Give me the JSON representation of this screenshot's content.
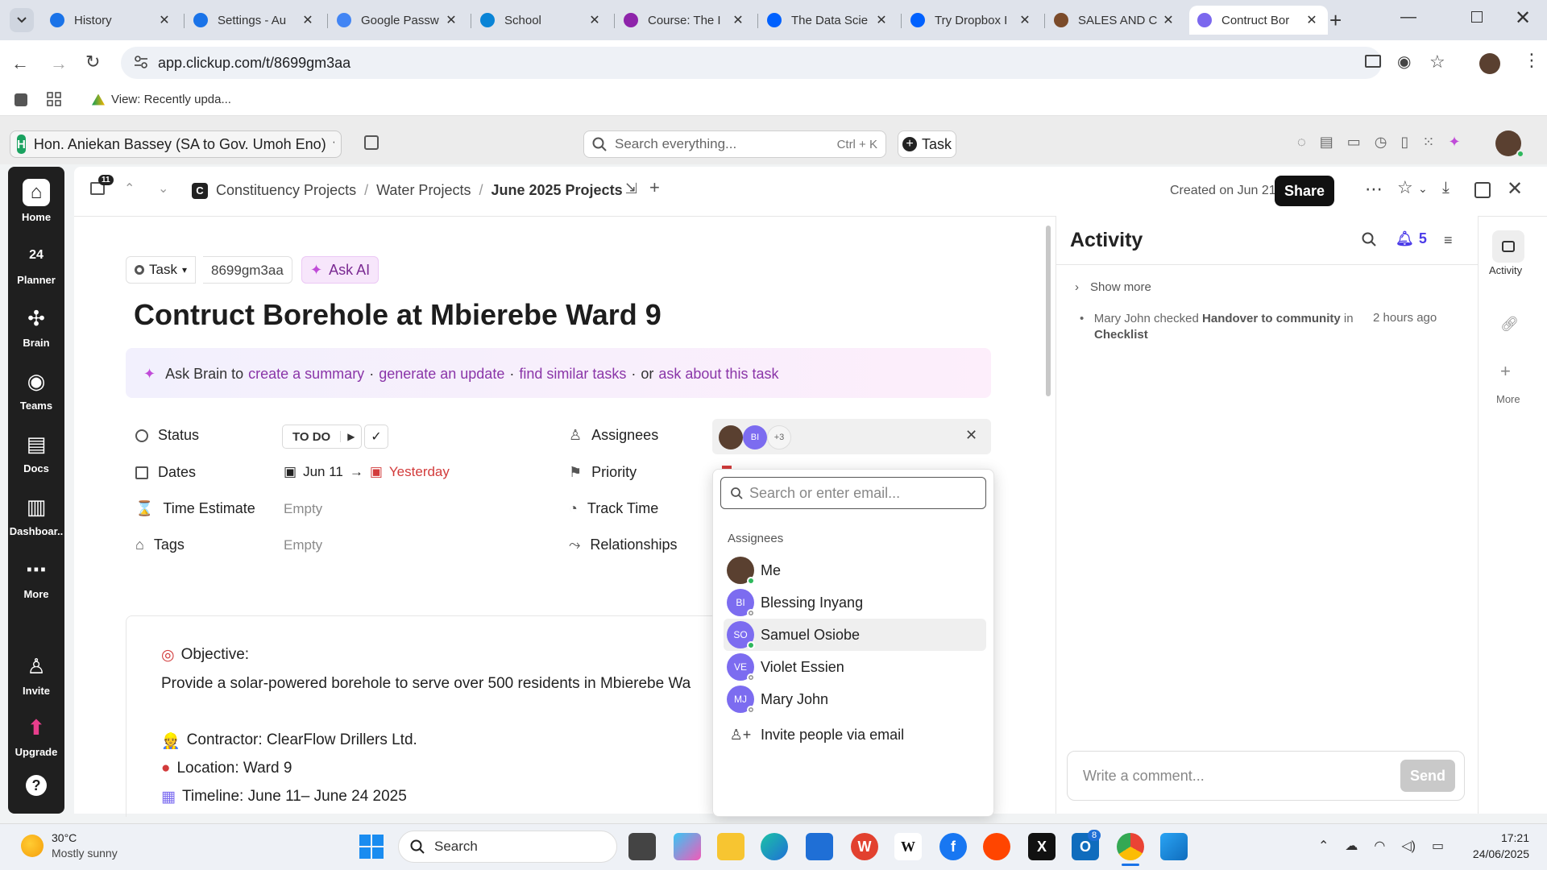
{
  "browser": {
    "tabs": [
      {
        "title": "History",
        "color": "#1a73e8"
      },
      {
        "title": "Settings - Au",
        "color": "#1a73e8"
      },
      {
        "title": "Google Passw",
        "color": "#4285f4"
      },
      {
        "title": "School",
        "color": "#0a84d6"
      },
      {
        "title": "Course: The I",
        "color": "#8e24aa"
      },
      {
        "title": "The Data Scie",
        "color": "#0061fe"
      },
      {
        "title": "Try Dropbox I",
        "color": "#0061fe"
      },
      {
        "title": "SALES AND C",
        "color": "#7b4b2a"
      },
      {
        "title": "Contruct Bor",
        "color": "#7b68ee"
      }
    ],
    "url": "app.clickup.com/t/8699gm3aa",
    "bookmark": "View: Recently upda..."
  },
  "clickup": {
    "workspace_initial": "H",
    "workspace": "Hon. Aniekan Bassey (SA to Gov. Umoh Eno)",
    "search_placeholder": "Search everything...",
    "search_shortcut": "Ctrl + K",
    "task_button": "Task",
    "rail": [
      {
        "label": "Home",
        "icon": "home-icon"
      },
      {
        "label": "Planner",
        "icon": "calendar-icon"
      },
      {
        "label": "Brain",
        "icon": "brain-icon"
      },
      {
        "label": "Teams",
        "icon": "teams-icon"
      },
      {
        "label": "Docs",
        "icon": "docs-icon"
      },
      {
        "label": "Dashboar..",
        "icon": "dashboard-icon"
      },
      {
        "label": "More",
        "icon": "more-icon"
      },
      {
        "label": "Invite",
        "icon": "invite-icon"
      },
      {
        "label": "Upgrade",
        "icon": "upgrade-icon"
      }
    ],
    "planner_badge": "24",
    "notif_badge": "11",
    "breadcrumb": {
      "space_initial": "C",
      "space": "Constituency Projects",
      "folder": "Water Projects",
      "list": "June 2025 Projects"
    },
    "created": "Created on Jun 21",
    "share": "Share"
  },
  "task": {
    "type": "Task",
    "id": "8699gm3aa",
    "ask_ai": "Ask AI",
    "title": "Contruct Borehole at Mbierebe Ward 9",
    "brain": {
      "prefix": "Ask Brain to",
      "link1": "create a summary",
      "link2": "generate an update",
      "link3": "find similar tasks",
      "or": "or",
      "link4": "ask about this task"
    },
    "props": {
      "status_label": "Status",
      "status_value": "TO DO",
      "dates_label": "Dates",
      "start": "Jun 11",
      "due": "Yesterday",
      "time_label": "Time Estimate",
      "time_value": "Empty",
      "tags_label": "Tags",
      "tags_value": "Empty",
      "assignees_label": "Assignees",
      "assignee_more": "+3",
      "priority_label": "Priority",
      "track_label": "Track Time",
      "rel_label": "Relationships"
    },
    "description": {
      "objective_heading": "Objective:",
      "objective": "Provide a solar-powered borehole to serve over 500 residents in Mbierebe Wa",
      "contractor": "Contractor: ClearFlow Drillers Ltd.",
      "location": "Location: Ward 9",
      "timeline": "Timeline: June 11– June 24 2025"
    }
  },
  "dropdown": {
    "search_placeholder": "Search or enter email...",
    "section": "Assignees",
    "people": [
      {
        "name": "Me",
        "initials": "",
        "color": "#5a4030",
        "status": "#2eb85c"
      },
      {
        "name": "Blessing Inyang",
        "initials": "BI",
        "color": "#7c6cf0",
        "status": "#ffffff"
      },
      {
        "name": "Samuel Osiobe",
        "initials": "SO",
        "color": "#7c6cf0",
        "status": "#2eb85c"
      },
      {
        "name": "Violet Essien",
        "initials": "VE",
        "color": "#7c6cf0",
        "status": "#ffffff"
      },
      {
        "name": "Mary John",
        "initials": "MJ",
        "color": "#7c6cf0",
        "status": "#ffffff"
      }
    ],
    "invite": "Invite people via email"
  },
  "activity": {
    "title": "Activity",
    "notif_count": "5",
    "show_more": "Show more",
    "entry_actor": "Mary John checked",
    "entry_item": "Handover to community",
    "entry_in": "in",
    "entry_list": "Checklist",
    "entry_time": "2 hours ago",
    "comment_placeholder": "Write a comment...",
    "send": "Send",
    "side": {
      "activity": "Activity",
      "more": "More"
    }
  },
  "taskbar": {
    "temp": "30°C",
    "weather": "Mostly sunny",
    "search": "Search",
    "time": "17:21",
    "date": "24/06/2025",
    "outlook_badge": "8"
  }
}
